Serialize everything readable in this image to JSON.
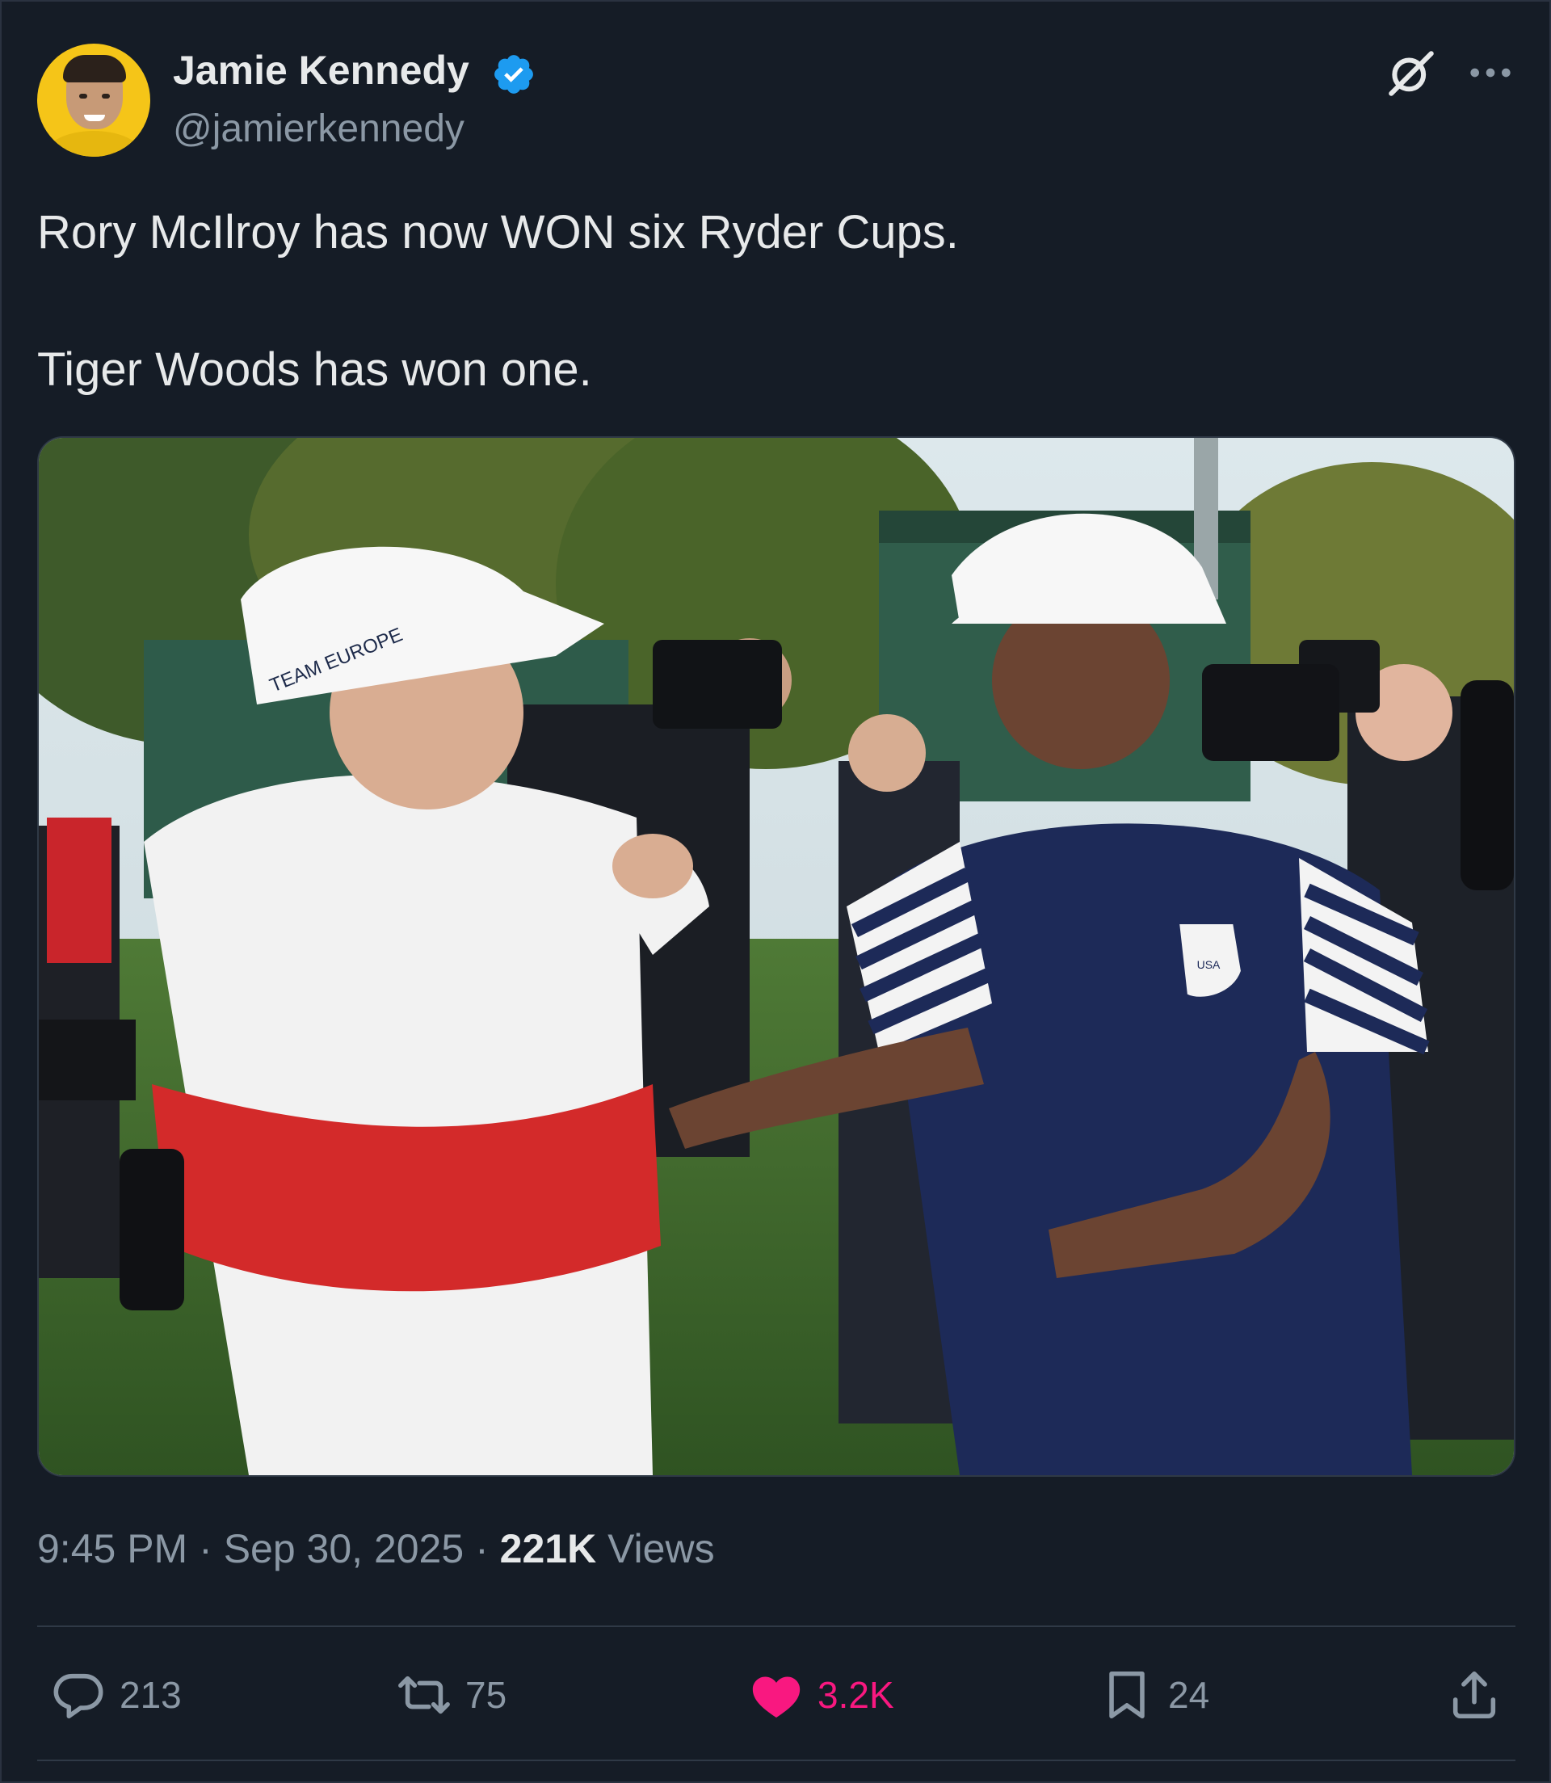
{
  "author": {
    "name": "Jamie Kennedy",
    "handle": "@jamierkennedy",
    "verified": true
  },
  "tweet": {
    "line1": "Rory McIlroy has now WON six Ryder Cups.",
    "line2": "Tiger Woods has won one."
  },
  "photo": {
    "cap_text_left": "TEAM EUROPE",
    "badge_text": "USA"
  },
  "meta": {
    "time": "9:45 PM",
    "separator": "·",
    "date": "Sep 30, 2025",
    "views_count": "221K",
    "views_label": "Views"
  },
  "actions": {
    "replies": "213",
    "reposts": "75",
    "likes": "3.2K",
    "bookmarks": "24"
  },
  "colors": {
    "background": "#151c26",
    "verified_blue": "#1d9bf0",
    "like_pink": "#f91880",
    "muted_text": "#8b98a5"
  },
  "icons": [
    "verified-badge-icon",
    "grok-icon",
    "more-icon",
    "reply-icon",
    "repost-icon",
    "like-icon",
    "bookmark-icon",
    "share-icon"
  ]
}
